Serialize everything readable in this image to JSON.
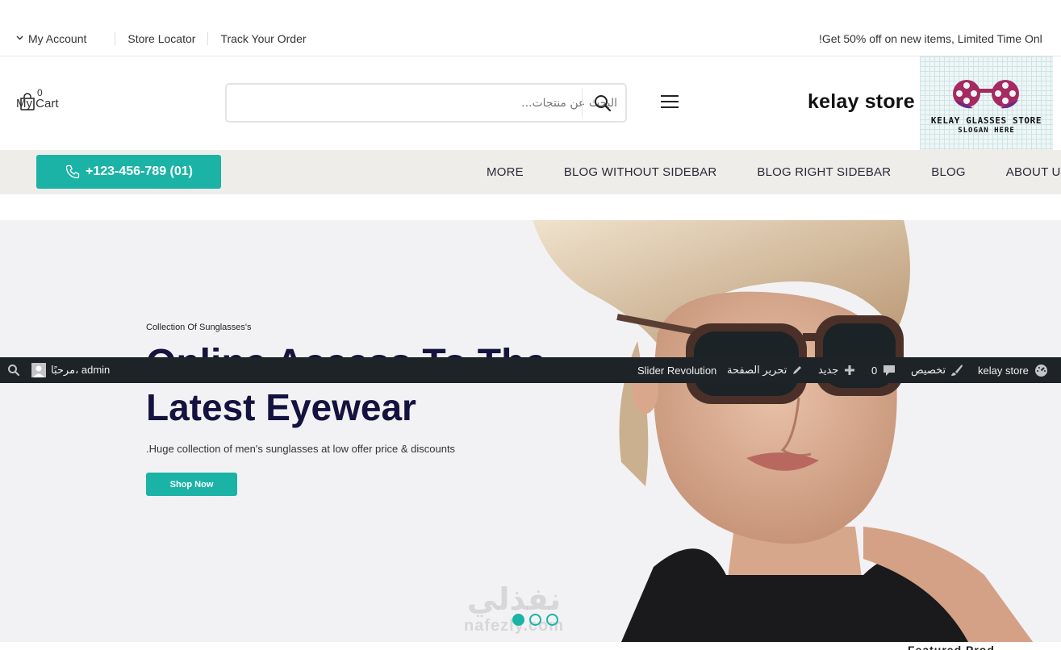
{
  "topbar": {
    "account_label": "My Account",
    "store_locator": "Store Locator",
    "track_order": "Track Your Order",
    "promo": "!Get 50% off on new items, Limited Time Onl"
  },
  "header": {
    "cart_count": "0",
    "cart_label": "My Cart",
    "search_placeholder": "البحث عن منتجات...",
    "brand": "kelay store",
    "logo_line1": "KELAY GLASSES STORE",
    "logo_line2": "SLOGAN HERE"
  },
  "nav": {
    "phone": "+123-456-789 (01)",
    "items": [
      "MORE",
      "BLOG WITHOUT SIDEBAR",
      "BLOG RIGHT SIDEBAR",
      "BLOG",
      "ABOUT US"
    ]
  },
  "hero": {
    "eyebrow": "Collection Of Sunglasses's",
    "headline1": "Online Access To The",
    "headline2": "Latest Eyewear",
    "desc": ".Huge collection of men's sunglasses at low offer price & discounts",
    "cta": "Shop Now",
    "watermark_ar": "نفذلي",
    "watermark_en": "nafezly.com"
  },
  "adminbar": {
    "site": "kelay store",
    "customize": "تخصيص",
    "comments_count": "0",
    "new": "جديد",
    "edit_page": "تحرير الصفحة",
    "slider": "Slider Revolution",
    "greeting": "مرحبًا، admin"
  },
  "footer_peek": "Featured Prod",
  "colors": {
    "accent": "#1bb3a6",
    "headline": "#14123e",
    "adminbar": "#1d2327",
    "nav_bg": "#efede9"
  }
}
